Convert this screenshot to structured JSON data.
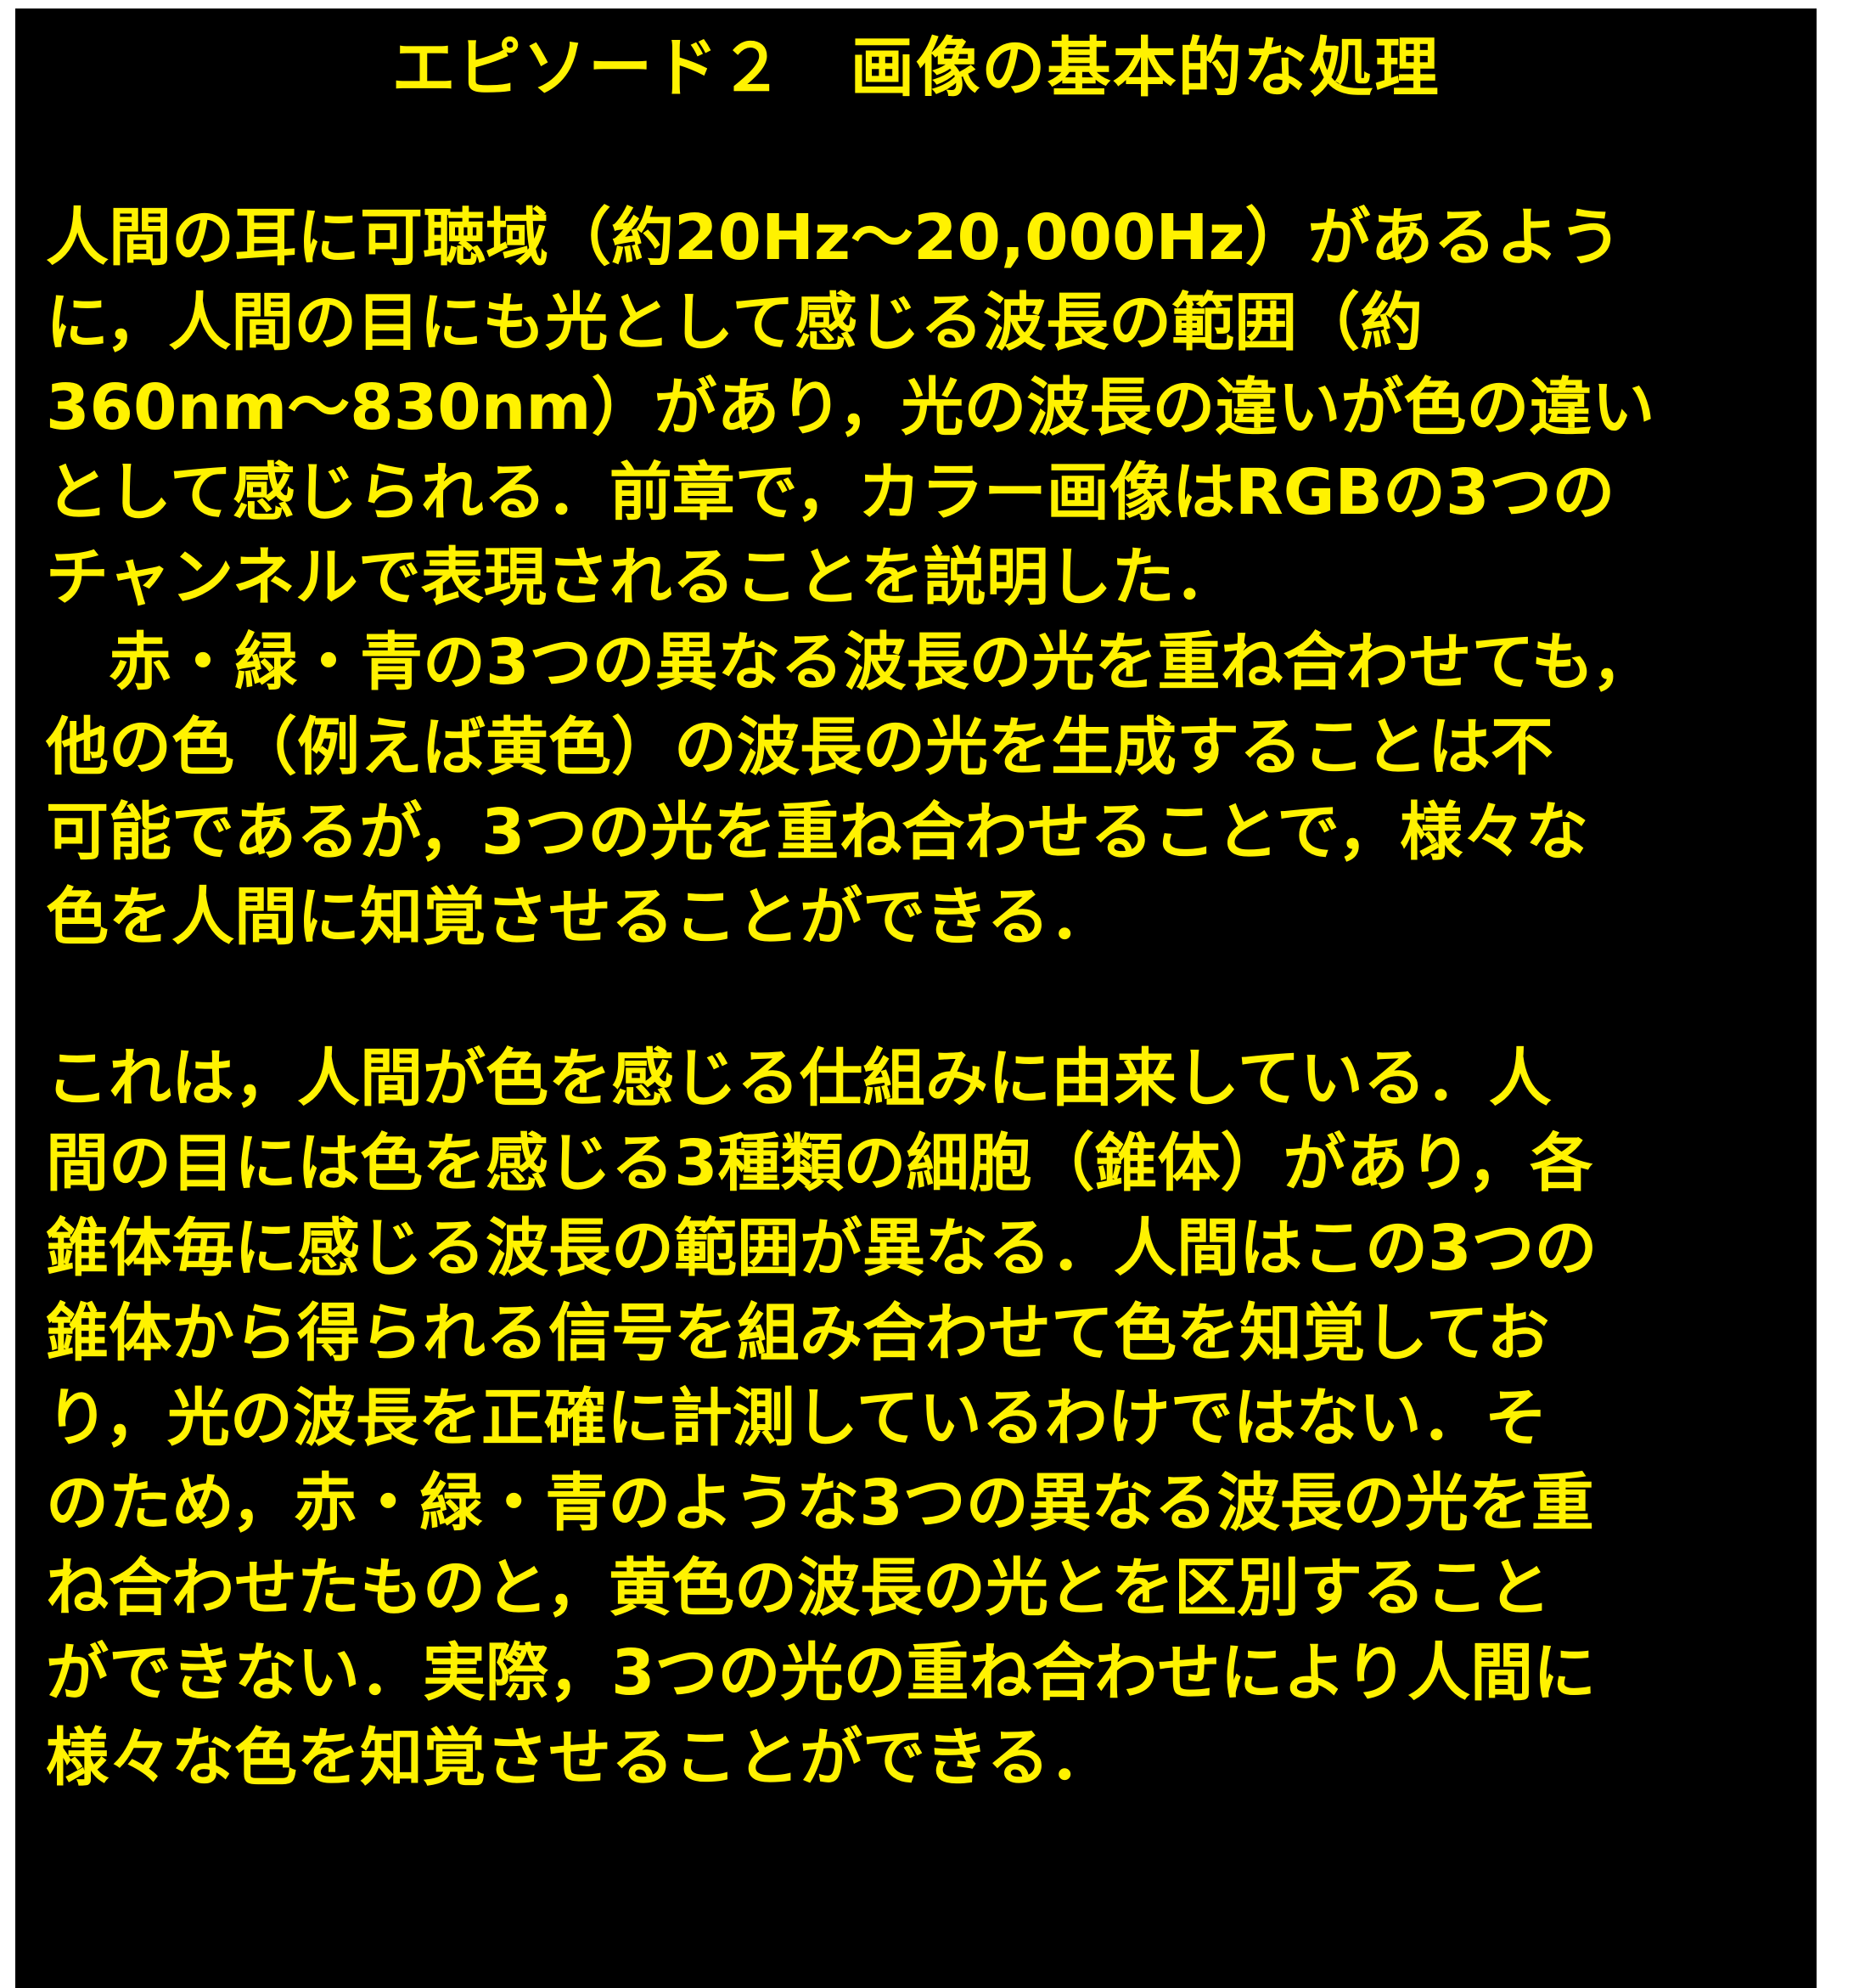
{
  "colors": {
    "background": "#000000",
    "text": "#FFF200",
    "margin": "#FFFFFF"
  },
  "title": "エピソード２　画像の基本的な処理",
  "paragraph1": {
    "lines": [
      "人間の耳に可聴域（約20Hz～20,000Hz）があるよう",
      "に，人間の目にも光として感じる波長の範囲（約",
      "360nm～830nm）があり，光の波長の違いが色の違い",
      "として感じられる．前章で，カラー画像はRGBの3つの",
      "チャンネルで表現されることを説明した．",
      "　赤・緑・青の3つの異なる波長の光を重ね合わせても，",
      "他の色（例えば黄色）の波長の光を生成することは不",
      "可能であるが，3つの光を重ね合わせることで，様々な",
      "色を人間に知覚させることができる．"
    ]
  },
  "paragraph2": {
    "lines": [
      "これは，人間が色を感じる仕組みに由来している．人",
      "間の目には色を感じる3種類の細胞（錐体）があり，各",
      "錐体毎に感じる波長の範囲が異なる．人間はこの3つの",
      "錐体から得られる信号を組み合わせて色を知覚してお",
      "り，光の波長を正確に計測しているわけではない．そ",
      "のため，赤・緑・青のような3つの異なる波長の光を重",
      "ね合わせたものと，黄色の波長の光とを区別すること",
      "ができない．実際，3つの光の重ね合わせにより人間に",
      "様々な色を知覚させることができる．"
    ]
  }
}
